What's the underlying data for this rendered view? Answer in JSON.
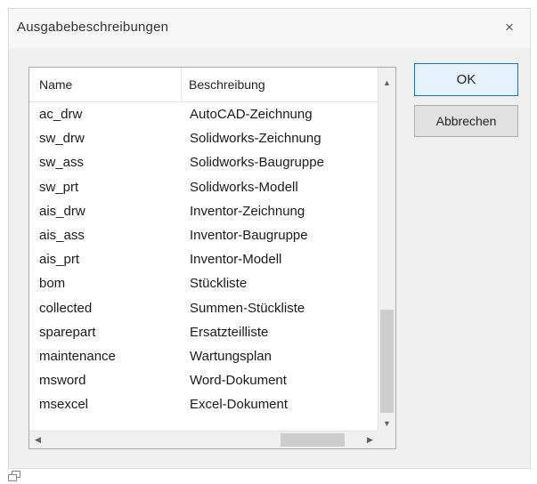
{
  "dialog": {
    "title": "Ausgabebeschreibungen",
    "close_icon": "close-icon",
    "close_glyph": "×"
  },
  "list": {
    "columns": [
      "Name",
      "Beschreibung"
    ],
    "rows": [
      {
        "name": "ac_drw",
        "description": "AutoCAD-Zeichnung"
      },
      {
        "name": "sw_drw",
        "description": "Solidworks-Zeichnung"
      },
      {
        "name": "sw_ass",
        "description": "Solidworks-Baugruppe"
      },
      {
        "name": "sw_prt",
        "description": "Solidworks-Modell"
      },
      {
        "name": "ais_drw",
        "description": "Inventor-Zeichnung"
      },
      {
        "name": "ais_ass",
        "description": "Inventor-Baugruppe"
      },
      {
        "name": "ais_prt",
        "description": "Inventor-Modell"
      },
      {
        "name": "bom",
        "description": "Stückliste"
      },
      {
        "name": "collected",
        "description": "Summen-Stückliste"
      },
      {
        "name": "sparepart",
        "description": "Ersatzteilliste"
      },
      {
        "name": "maintenance",
        "description": "Wartungsplan"
      },
      {
        "name": "msword",
        "description": "Word-Dokument"
      },
      {
        "name": "msexcel",
        "description": "Excel-Dokument"
      }
    ],
    "scroll_glyphs": {
      "up": "▲",
      "down": "▼",
      "left": "◀",
      "right": "▶"
    }
  },
  "buttons": {
    "ok_label": "OK",
    "cancel_label": "Abbrechen"
  },
  "icons": {
    "resize": "resize-handle-icon"
  },
  "colors": {
    "dialog_bg": "#f0f0f0",
    "default_button_border": "#0078d7",
    "default_button_bg": "#e5f1fb"
  }
}
